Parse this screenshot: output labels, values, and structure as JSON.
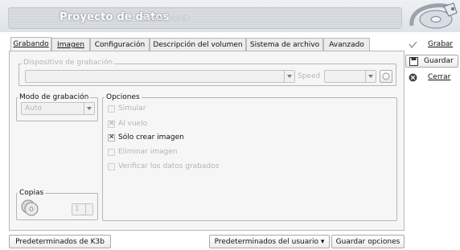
{
  "window": {
    "title": "Proyecto de datos",
    "size_label": "Tamaño: 14,0 KB"
  },
  "tabs": [
    "Grabando",
    "Imagen",
    "Configuración",
    "Descripción del volumen",
    "Sistema de archivo",
    "Avanzado"
  ],
  "device": {
    "legend": "Dispositivo de grabación",
    "speed_label": "Speed"
  },
  "mode": {
    "legend": "Modo de grabación",
    "value": "Auto"
  },
  "options": {
    "legend": "Opciones",
    "items": [
      {
        "label": "Simular",
        "checked": false,
        "enabled": false
      },
      {
        "label": "Al vuelo",
        "checked": true,
        "enabled": false
      },
      {
        "label": "Sólo crear imagen",
        "checked": true,
        "enabled": true
      },
      {
        "label": "Eliminar imagen",
        "checked": false,
        "enabled": false
      },
      {
        "label": "Verificar los datos grabados",
        "checked": false,
        "enabled": false
      }
    ]
  },
  "copies": {
    "legend": "Copias",
    "value": "1"
  },
  "side_buttons": {
    "burn": "Grabar",
    "save": "Guardar",
    "close": "Cerrar"
  },
  "bottom_buttons": {
    "k3b_defaults": "Predeterminados de K3b",
    "user_defaults": "Predeterminados del usuario",
    "save_options": "Guardar opciones"
  },
  "colors": {
    "header_text": "#ffffff",
    "disabled_text": "#b4b4b4",
    "close_icon": "#444444"
  }
}
